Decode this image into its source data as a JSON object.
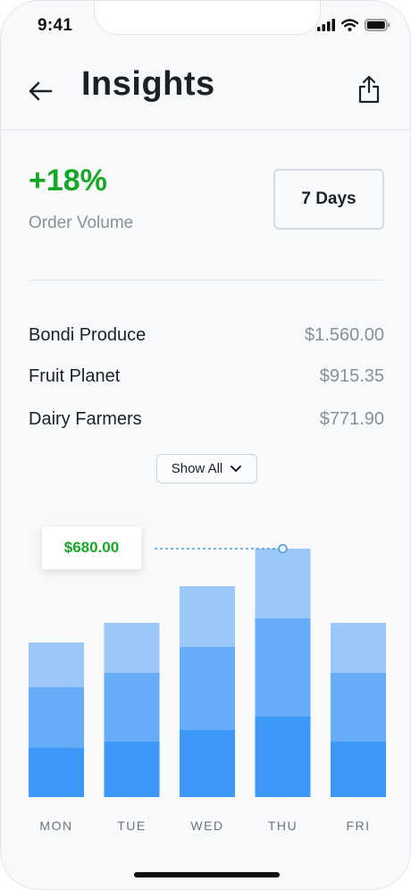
{
  "status_bar": {
    "time": "9:41"
  },
  "header": {
    "title": "Insights"
  },
  "summary": {
    "change": "+18%",
    "label": "Order Volume",
    "range_button": "7 Days"
  },
  "suppliers": [
    {
      "name": "Bondi Produce",
      "amount": "$1.560.00"
    },
    {
      "name": "Fruit Planet",
      "amount": "$915.35"
    },
    {
      "name": "Dairy Farmers",
      "amount": "$771.90"
    }
  ],
  "show_all_label": "Show All",
  "tooltip": {
    "value": "$680.00"
  },
  "colors": {
    "accent_green": "#15a826",
    "bar_dark": "#3b97f8",
    "bar_mid": "#66acf8",
    "bar_light": "#9bc8f9"
  },
  "chart_data": {
    "type": "bar",
    "stacked": true,
    "categories": [
      "MON",
      "TUE",
      "WED",
      "THU",
      "FRI"
    ],
    "series": [
      {
        "values": [
          55,
          62,
          75,
          90,
          62
        ]
      },
      {
        "values": [
          68,
          77,
          93,
          110,
          77
        ]
      },
      {
        "values": [
          50,
          56,
          68,
          78,
          56
        ]
      }
    ],
    "highlight": {
      "category": "THU",
      "value_label": "$680.00"
    },
    "ylim": [
      0,
      300
    ],
    "grid": false
  }
}
